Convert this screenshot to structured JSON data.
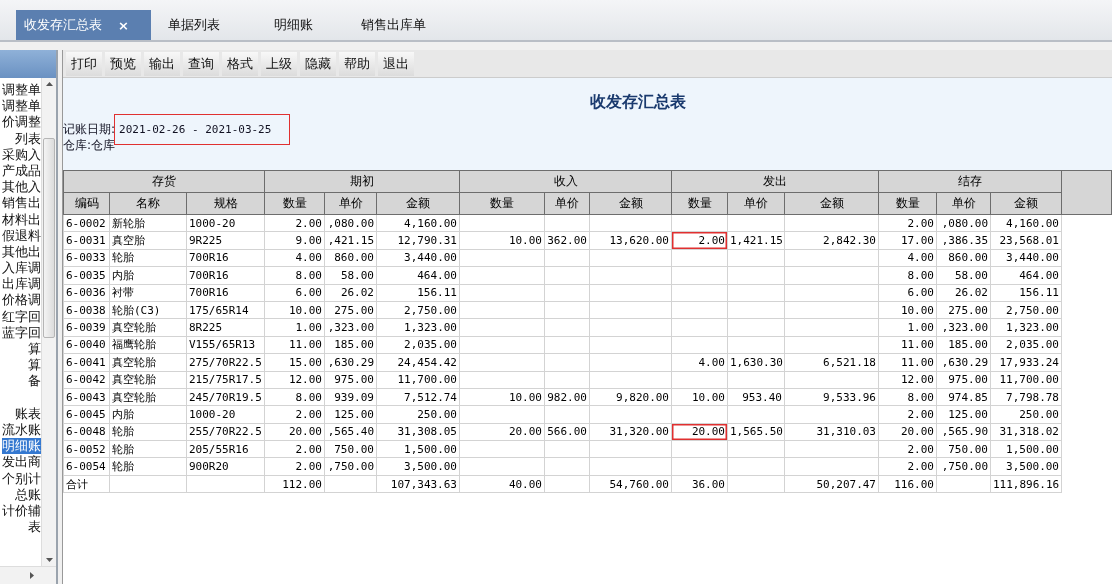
{
  "tabs": [
    {
      "label": "收发存汇总表",
      "selected": true,
      "close": "×"
    },
    {
      "label": "单据列表",
      "selected": false
    },
    {
      "label": "明细账",
      "selected": false
    },
    {
      "label": "销售出库单",
      "selected": false
    }
  ],
  "sidebar": {
    "items": [
      {
        "label": "调整单",
        "selected": false
      },
      {
        "label": "调整单",
        "selected": false
      },
      {
        "label": "价调整",
        "selected": false
      },
      {
        "label": "列表",
        "selected": false
      },
      {
        "label": "采购入",
        "selected": false
      },
      {
        "label": "产成品",
        "selected": false
      },
      {
        "label": "其他入",
        "selected": false
      },
      {
        "label": "销售出",
        "selected": false
      },
      {
        "label": "材料出",
        "selected": false
      },
      {
        "label": "假退料",
        "selected": false
      },
      {
        "label": "其他出",
        "selected": false
      },
      {
        "label": "入库调",
        "selected": false
      },
      {
        "label": "出库调",
        "selected": false
      },
      {
        "label": "价格调",
        "selected": false
      },
      {
        "label": "红字回",
        "selected": false
      },
      {
        "label": "蓝字回",
        "selected": false
      },
      {
        "label": "算",
        "selected": false
      },
      {
        "label": "算",
        "selected": false
      },
      {
        "label": "备",
        "selected": false
      },
      {
        "label": "账表",
        "selected": false
      },
      {
        "label": "流水账",
        "selected": false
      },
      {
        "label": "明细账",
        "selected": true
      },
      {
        "label": "发出商",
        "selected": false
      },
      {
        "label": "个别计",
        "selected": false
      },
      {
        "label": "总账",
        "selected": false
      },
      {
        "label": "计价辅",
        "selected": false
      },
      {
        "label": "表",
        "selected": false
      }
    ]
  },
  "toolbar": [
    "打印",
    "预览",
    "输出",
    "查询",
    "格式",
    "上级",
    "隐藏",
    "帮助",
    "退出"
  ],
  "report": {
    "title": "收发存汇总表",
    "period": {
      "label": "记账日期:",
      "value": "2021-02-26 - 2021-03-25",
      "marked": true
    },
    "warehouse": {
      "label": "仓库:",
      "value": "仓库"
    }
  },
  "table": {
    "groups": [
      {
        "label": "存货"
      },
      {
        "label": "期初"
      },
      {
        "label": "收入"
      },
      {
        "label": "发出"
      },
      {
        "label": "结存"
      }
    ],
    "columns": [
      "编码",
      "名称",
      "规格",
      "数量",
      "单价",
      "金额",
      "数量",
      "单价",
      "金额",
      "数量",
      "单价",
      "金额",
      "数量",
      "单价",
      "金额"
    ],
    "rows": [
      [
        "6-0002",
        "新轮胎",
        "1000-20",
        "2.00",
        ",080.00",
        "4,160.00",
        "",
        "",
        "",
        "",
        "",
        "",
        "2.00",
        ",080.00",
        "4,160.00"
      ],
      [
        "6-0031",
        "真空胎",
        "9R225",
        "9.00",
        ",421.15",
        "12,790.31",
        "10.00",
        "362.00",
        "13,620.00",
        {
          "text": "2.00",
          "marked": true
        },
        "1,421.15",
        "2,842.30",
        "17.00",
        ",386.35",
        "23,568.01"
      ],
      [
        "6-0033",
        "轮胎",
        "700R16",
        "4.00",
        "860.00",
        "3,440.00",
        "",
        "",
        "",
        "",
        "",
        "",
        "4.00",
        "860.00",
        "3,440.00"
      ],
      [
        "6-0035",
        "内胎",
        "700R16",
        "8.00",
        "58.00",
        "464.00",
        "",
        "",
        "",
        "",
        "",
        "",
        "8.00",
        "58.00",
        "464.00"
      ],
      [
        "6-0036",
        "衬带",
        "700R16",
        "6.00",
        "26.02",
        "156.11",
        "",
        "",
        "",
        "",
        "",
        "",
        "6.00",
        "26.02",
        "156.11"
      ],
      [
        "6-0038",
        "轮胎(C3)",
        "175/65R14",
        "10.00",
        "275.00",
        "2,750.00",
        "",
        "",
        "",
        "",
        "",
        "",
        "10.00",
        "275.00",
        "2,750.00"
      ],
      [
        "6-0039",
        "真空轮胎",
        "8R225",
        "1.00",
        ",323.00",
        "1,323.00",
        "",
        "",
        "",
        "",
        "",
        "",
        "1.00",
        ",323.00",
        "1,323.00"
      ],
      [
        "6-0040",
        "福鹰轮胎",
        "V155/65R13",
        "11.00",
        "185.00",
        "2,035.00",
        "",
        "",
        "",
        "",
        "",
        "",
        "11.00",
        "185.00",
        "2,035.00"
      ],
      [
        "6-0041",
        "真空轮胎",
        "275/70R22.5",
        "15.00",
        ",630.29",
        "24,454.42",
        "",
        "",
        "",
        "4.00",
        "1,630.30",
        "6,521.18",
        "11.00",
        ",630.29",
        "17,933.24"
      ],
      [
        "6-0042",
        "真空轮胎",
        "215/75R17.5",
        "12.00",
        "975.00",
        "11,700.00",
        "",
        "",
        "",
        "",
        "",
        "",
        "12.00",
        "975.00",
        "11,700.00"
      ],
      [
        "6-0043",
        "真空轮胎",
        "245/70R19.5",
        "8.00",
        "939.09",
        "7,512.74",
        "10.00",
        "982.00",
        "9,820.00",
        "10.00",
        "953.40",
        "9,533.96",
        "8.00",
        "974.85",
        "7,798.78"
      ],
      [
        "6-0045",
        "内胎",
        "1000-20",
        "2.00",
        "125.00",
        "250.00",
        "",
        "",
        "",
        "",
        "",
        "",
        "2.00",
        "125.00",
        "250.00"
      ],
      [
        "6-0048",
        "轮胎",
        "255/70R22.5",
        "20.00",
        ",565.40",
        "31,308.05",
        "20.00",
        "566.00",
        "31,320.00",
        {
          "text": "20.00",
          "marked": true
        },
        "1,565.50",
        "31,310.03",
        "20.00",
        ",565.90",
        "31,318.02"
      ],
      [
        "6-0052",
        "轮胎",
        "205/55R16",
        "2.00",
        "750.00",
        "1,500.00",
        "",
        "",
        "",
        "",
        "",
        "",
        "2.00",
        "750.00",
        "1,500.00"
      ],
      [
        "6-0054",
        "轮胎",
        "900R20",
        "2.00",
        ",750.00",
        "3,500.00",
        "",
        "",
        "",
        "",
        "",
        "",
        "2.00",
        ",750.00",
        "3,500.00"
      ],
      [
        "合计",
        "",
        "",
        "112.00",
        "",
        "107,343.63",
        "40.00",
        "",
        "54,760.00",
        "36.00",
        "",
        "50,207.47",
        "116.00",
        "",
        "111,896.16"
      ]
    ]
  }
}
